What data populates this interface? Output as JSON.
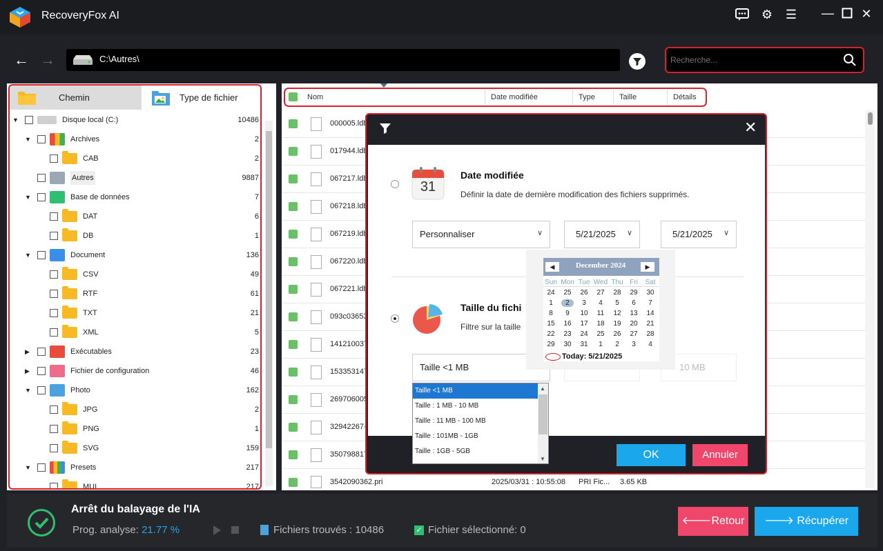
{
  "app": {
    "title": "RecoveryFox AI"
  },
  "path": {
    "current": "C:\\Autres\\"
  },
  "search": {
    "placeholder": "Recherche..."
  },
  "left": {
    "tabs": [
      "Chemin",
      "Type de fichier"
    ],
    "items": [
      {
        "label": "Disque local (C:)",
        "count": "10486"
      },
      {
        "label": "Archives",
        "count": "2"
      },
      {
        "label": "CAB",
        "count": "2"
      },
      {
        "label": "Autres",
        "count": "9887"
      },
      {
        "label": "Base de données",
        "count": "7"
      },
      {
        "label": "DAT",
        "count": "6"
      },
      {
        "label": "DB",
        "count": "1"
      },
      {
        "label": "Document",
        "count": "136"
      },
      {
        "label": "CSV",
        "count": "49"
      },
      {
        "label": "RTF",
        "count": "61"
      },
      {
        "label": "TXT",
        "count": "21"
      },
      {
        "label": "XML",
        "count": "5"
      },
      {
        "label": "Exécutables",
        "count": "23"
      },
      {
        "label": "Fichier de configuration",
        "count": "46"
      },
      {
        "label": "Photo",
        "count": "162"
      },
      {
        "label": "JPG",
        "count": "2"
      },
      {
        "label": "PNG",
        "count": "1"
      },
      {
        "label": "SVG",
        "count": "159"
      },
      {
        "label": "Presets",
        "count": "217"
      },
      {
        "label": "MUI",
        "count": "217"
      }
    ]
  },
  "table": {
    "headers": [
      "Nom",
      "Date modifiée",
      "Type",
      "Taille",
      "Détails"
    ],
    "rows": [
      {
        "name": "000005.ldb"
      },
      {
        "name": "017944.ldb"
      },
      {
        "name": "067217.ldb"
      },
      {
        "name": "067218.ldb"
      },
      {
        "name": "067219.ldb"
      },
      {
        "name": "067220.ldb"
      },
      {
        "name": "067221.ldb"
      },
      {
        "name": "093c03653"
      },
      {
        "name": "141210037"
      },
      {
        "name": "153353147"
      },
      {
        "name": "269706005"
      },
      {
        "name": "32942267-"
      },
      {
        "name": "350798817"
      },
      {
        "name": "3542090362.pri",
        "date": "2025/03/31 : 10:55:08",
        "type": "PRI Fic...",
        "size": "3.65 KB"
      }
    ]
  },
  "dialog": {
    "date": {
      "icon_day": "31",
      "title": "Date modifiée",
      "desc": "Définir la date de dernière modification des fichiers supprimés.",
      "preset": "Personnaliser",
      "from": "5/21/2025",
      "to": "5/21/2025"
    },
    "size": {
      "title": "Taille du fichi",
      "desc": "Filtre sur la taille",
      "preset": "Taille <1 MB",
      "to": "10 MB",
      "options": [
        "Taille <1 MB",
        "Taille : 1 MB - 10 MB",
        "Taille : 11 MB - 100 MB",
        "Taille : 101MB - 1GB",
        "Taille : 1GB - 5GB"
      ]
    },
    "ok": "OK",
    "cancel": "Annuler"
  },
  "calendar": {
    "month": "December 2024",
    "weekdays": [
      "Sun",
      "Mon",
      "Tue",
      "Wed",
      "Thu",
      "Fri",
      "Sat"
    ],
    "weeks": [
      [
        "24",
        "25",
        "26",
        "27",
        "28",
        "29",
        "30"
      ],
      [
        "1",
        "2",
        "3",
        "4",
        "5",
        "6",
        "7"
      ],
      [
        "8",
        "9",
        "10",
        "11",
        "12",
        "13",
        "14"
      ],
      [
        "15",
        "16",
        "17",
        "18",
        "19",
        "20",
        "21"
      ],
      [
        "22",
        "23",
        "24",
        "25",
        "26",
        "27",
        "28"
      ],
      [
        "29",
        "30",
        "31",
        "1",
        "2",
        "3",
        "4"
      ]
    ],
    "today": "Today: 5/21/2025"
  },
  "status": {
    "title": "Arrêt du balayage de l'IA",
    "progress_label": "Prog. analyse:",
    "progress_value": "21.77 %",
    "found_label": "Fichiers trouvés : 10486",
    "selected_label": "Fichier sélectionné: 0",
    "retour": "Retour",
    "recuperer": "Récupérer"
  },
  "colors": {
    "accent_red": "#d8222b",
    "blue": "#1aa7ec",
    "pink": "#f1466c",
    "green": "#6abf69"
  }
}
